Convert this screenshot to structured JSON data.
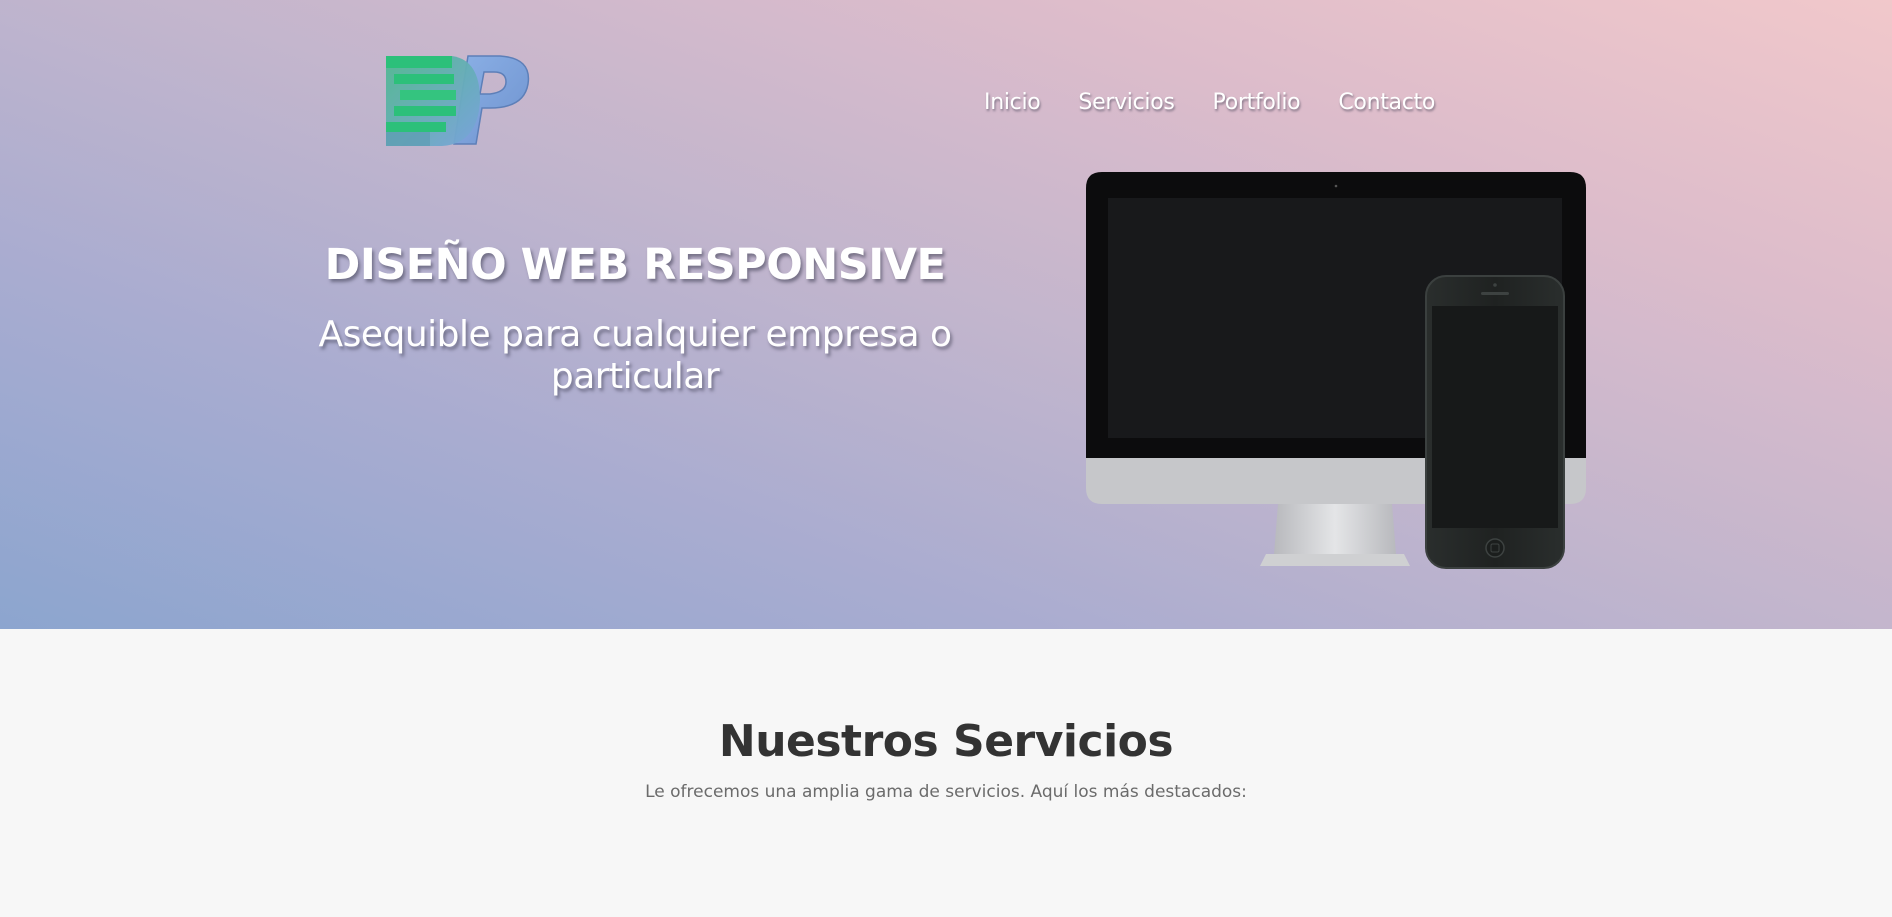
{
  "header": {
    "logo_icon": "dp-logo-icon",
    "nav": [
      {
        "label": "Inicio"
      },
      {
        "label": "Servicios"
      },
      {
        "label": "Portfolio"
      },
      {
        "label": "Contacto"
      }
    ]
  },
  "hero": {
    "title": "DISEÑO WEB RESPONSIVE",
    "subtitle": "Asequible para cualquier empresa o particular",
    "illustration_icon": "devices-mockup-icon"
  },
  "services": {
    "title": "Nuestros Servicios",
    "subtitle": "Le ofrecemos una amplia gama de servicios. Aquí los más destacados:"
  },
  "colors": {
    "gradient_top_right": "#f1c8cb",
    "gradient_bottom_left": "#8ca5cf",
    "logo_green": "#2cc07a",
    "logo_blue": "#7ba0d8",
    "section_bg": "#f7f7f7"
  }
}
